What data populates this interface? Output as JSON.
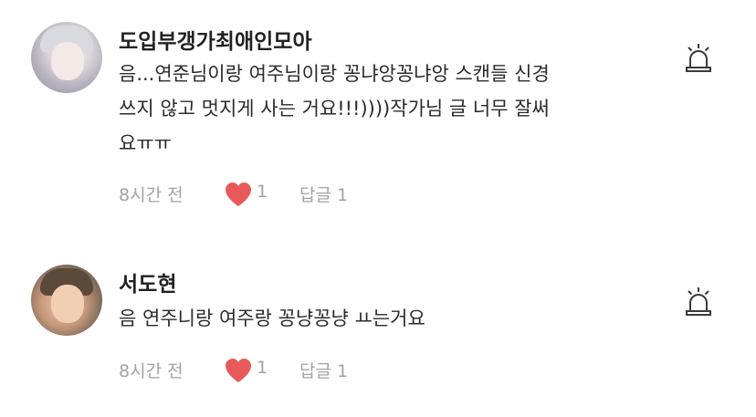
{
  "comments": [
    {
      "username": "도입부갱가최애인모아",
      "text": "음...연준님이랑 여주님이랑 꽁냐앙꽁냐앙 스캔들 신경\n쓰지 않고 멋지게 사는 거요!!!))))작가님 글 너무 잘써\n요ㅠㅠ",
      "time": "8시간 전",
      "likes": "1",
      "reply": "답글 1",
      "avatar_icon": "avatar-photo",
      "heart_color": "#e85a5a"
    },
    {
      "username": "서도현",
      "text": "음 연주니랑 여주랑 꽁냥꽁냥 ㅛ는거요",
      "time": "8시간 전",
      "likes": "1",
      "reply": "답글 1",
      "avatar_icon": "avatar-photo",
      "heart_color": "#e85a5a"
    }
  ]
}
